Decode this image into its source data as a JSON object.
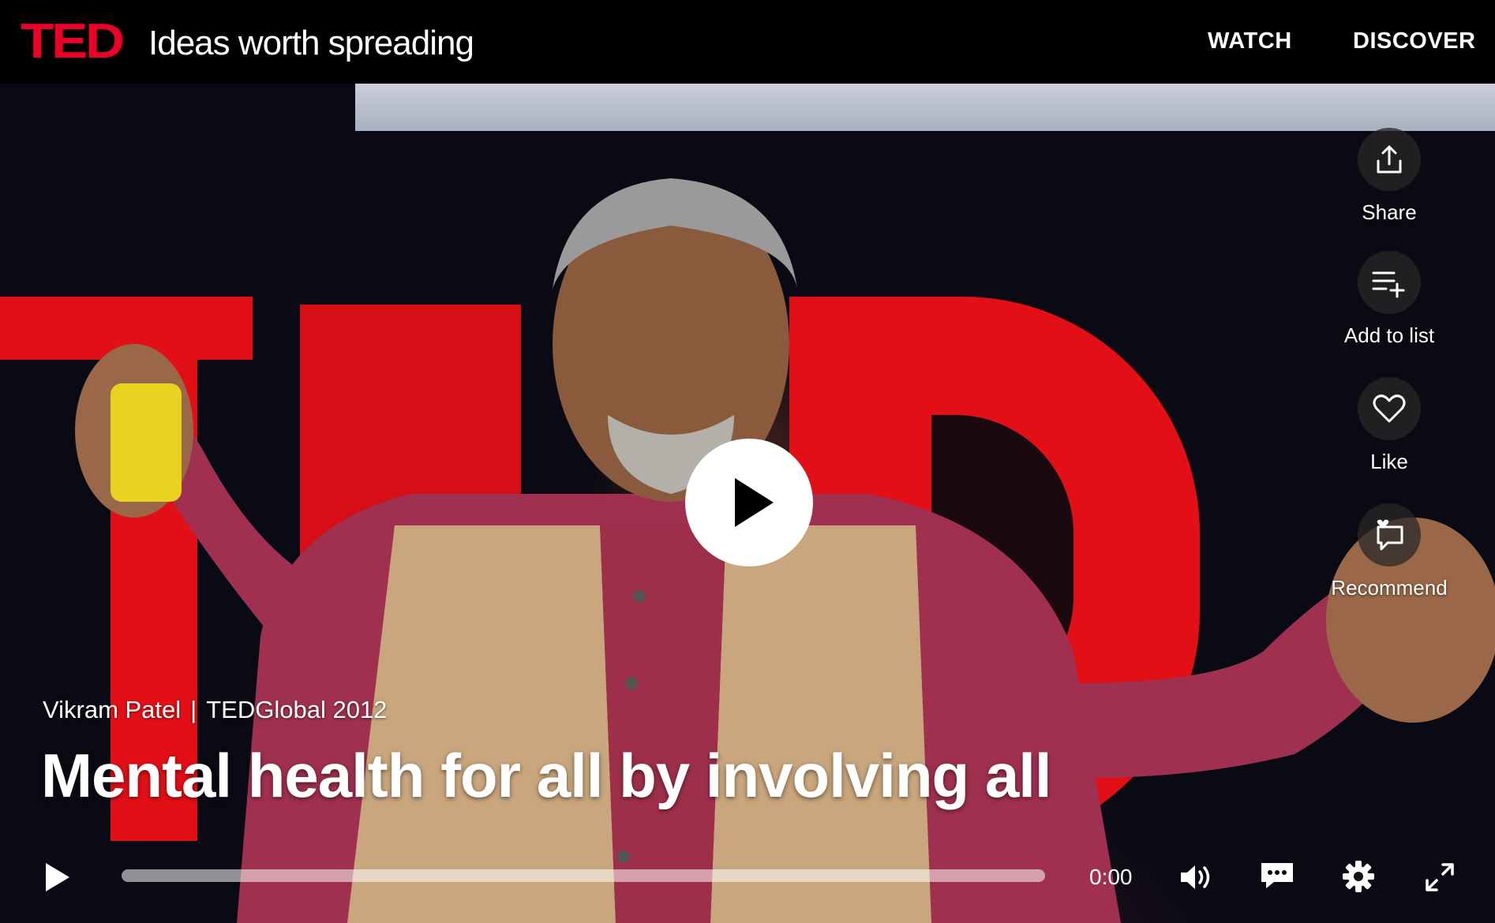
{
  "header": {
    "logo": "TED",
    "tagline": "Ideas worth spreading",
    "nav": [
      {
        "label": "WATCH"
      },
      {
        "label": "DISCOVER"
      }
    ]
  },
  "talk": {
    "speaker": "Vikram Patel",
    "event": "TEDGlobal 2012",
    "title": "Mental health for all by involving all"
  },
  "actions": [
    {
      "label": "Share",
      "icon": "share-icon"
    },
    {
      "label": "Add to list",
      "icon": "add-to-list-icon"
    },
    {
      "label": "Like",
      "icon": "heart-icon"
    },
    {
      "label": "Recommend",
      "icon": "recommend-icon"
    }
  ],
  "player": {
    "time": "0:00",
    "progress": 0
  },
  "colors": {
    "ted_red": "#eb0028",
    "background": "#000000",
    "text": "#ffffff"
  }
}
